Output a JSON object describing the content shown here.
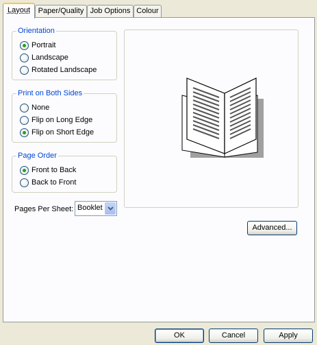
{
  "tabs": [
    {
      "label": "Layout",
      "active": true
    },
    {
      "label": "Paper/Quality",
      "active": false
    },
    {
      "label": "Job Options",
      "active": false
    },
    {
      "label": "Colour",
      "active": false
    }
  ],
  "orientation": {
    "title": "Orientation",
    "options": [
      {
        "label": "Portrait",
        "selected": true
      },
      {
        "label": "Landscape",
        "selected": false
      },
      {
        "label": "Rotated Landscape",
        "selected": false
      }
    ]
  },
  "print_both_sides": {
    "title": "Print on Both Sides",
    "options": [
      {
        "label": "None",
        "selected": false
      },
      {
        "label": "Flip on Long Edge",
        "selected": false
      },
      {
        "label": "Flip on Short Edge",
        "selected": true
      }
    ]
  },
  "page_order": {
    "title": "Page Order",
    "options": [
      {
        "label": "Front to Back",
        "selected": true
      },
      {
        "label": "Back to Front",
        "selected": false
      }
    ]
  },
  "pages_per_sheet": {
    "label": "Pages Per Sheet:",
    "value": "Booklet"
  },
  "preview": {
    "icon": "booklet-icon"
  },
  "buttons": {
    "advanced": "Advanced...",
    "ok": "OK",
    "cancel": "Cancel",
    "apply": "Apply"
  },
  "colors": {
    "group_title": "#0046D5",
    "active_tab_highlight": "#FFC83C",
    "radio_selected": "#21A121",
    "background": "#ECE9D8"
  }
}
